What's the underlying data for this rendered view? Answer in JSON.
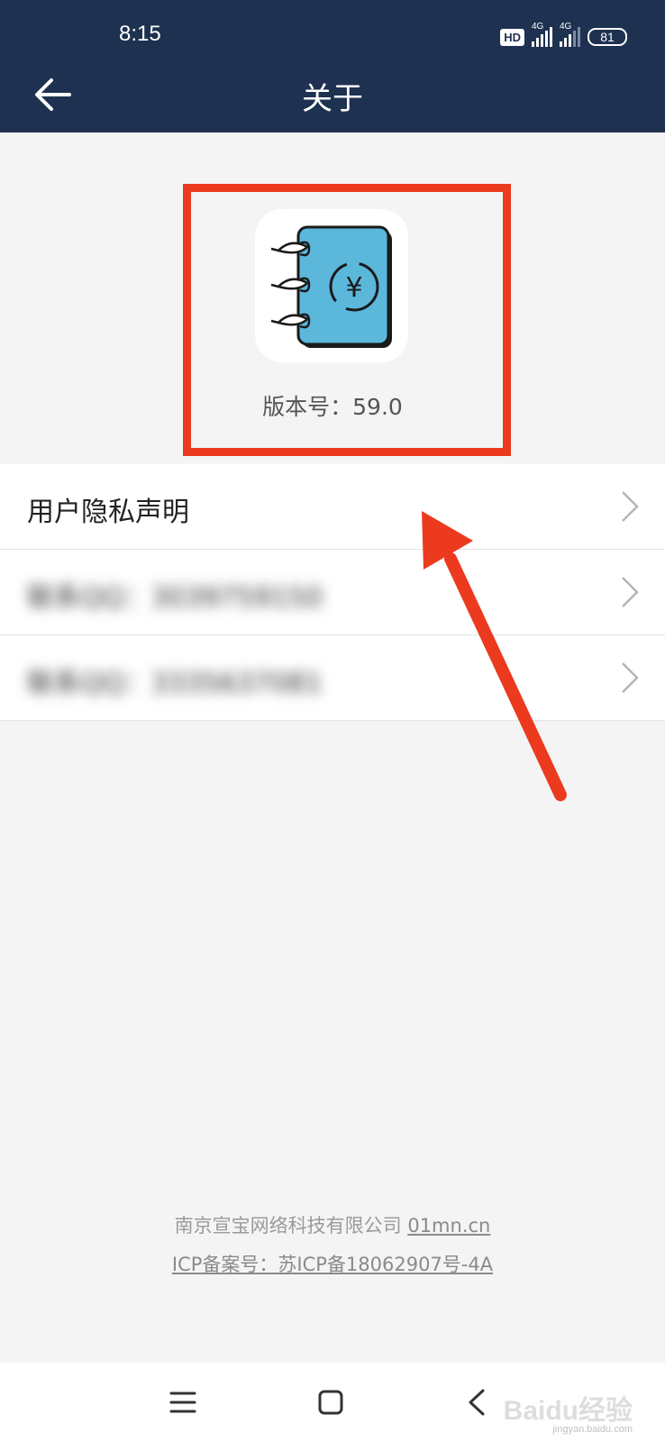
{
  "status_bar": {
    "time": "8:15",
    "hd_label": "HD",
    "signal1_label": "4G",
    "signal2_label": "4G",
    "battery": "81"
  },
  "header": {
    "title": "关于",
    "back_icon": "back-arrow-icon"
  },
  "about": {
    "app_icon": "notebook-yen-icon",
    "version": "版本号：59.0"
  },
  "menu": {
    "items": [
      {
        "label": "用户隐私声明",
        "icon": "chevron-right-icon"
      },
      {
        "label": "联系QQ：3039759150",
        "icon": "chevron-right-icon"
      },
      {
        "label": "联系QQ：3335637081",
        "icon": "chevron-right-icon"
      }
    ]
  },
  "footer": {
    "company": "南京宣宝网络科技有限公司",
    "site": "01mn.cn",
    "icp": "ICP备案号：苏ICP备18062907号-4A"
  },
  "navbar": {
    "menu_icon": "menu-icon",
    "home_icon": "home-square-icon",
    "back_icon": "back-triangle-icon"
  },
  "watermark": {
    "text": "Baidu经验",
    "sub": "jingyan.baidu.com"
  },
  "colors": {
    "header_bg": "#1e3150",
    "annotation_red": "#ec3a1f",
    "icon_blue": "#5bb8db"
  }
}
